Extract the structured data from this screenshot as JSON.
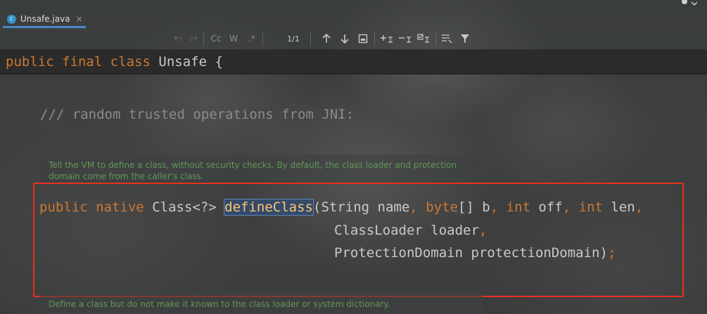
{
  "tab": {
    "filename": "Unsafe.java",
    "close": "×"
  },
  "findbar": {
    "match_case": "Cc",
    "words": "W",
    "regex": ".*",
    "count": "1/1"
  },
  "class_decl": {
    "kw1": "public",
    "kw2": "final",
    "kw3": "class",
    "name": "Unsafe",
    "brace": "{"
  },
  "comment": "/// random trusted operations from JNI:",
  "doc1": "Tell the VM to define a class, without security checks. By default, the class loader and protection domain come from the caller's class.",
  "method": {
    "kw_public": "public",
    "kw_native": "native",
    "ret_type": "Class<?>",
    "name": "defineClass",
    "open_paren": "(",
    "p1_type": "String",
    "p1_name": " name",
    "comma": ",",
    "p2_type": "byte",
    "p2_suffix": "[] b",
    "p3_type": "int",
    "p3_name": " off",
    "p4_type": "int",
    "p4_name": " len",
    "line2": "ClassLoader loader",
    "line3": "ProtectionDomain protectionDomain)",
    "semicolon": ";"
  },
  "doc2": "Define a class but do not make it known to the class loader or system dictionary.",
  "colors": {
    "keyword": "#cc7832",
    "method_name": "#ffc66d",
    "doc_text": "#629755",
    "annotation_box": "#e8301d",
    "tab_accent": "#4a88c7"
  }
}
